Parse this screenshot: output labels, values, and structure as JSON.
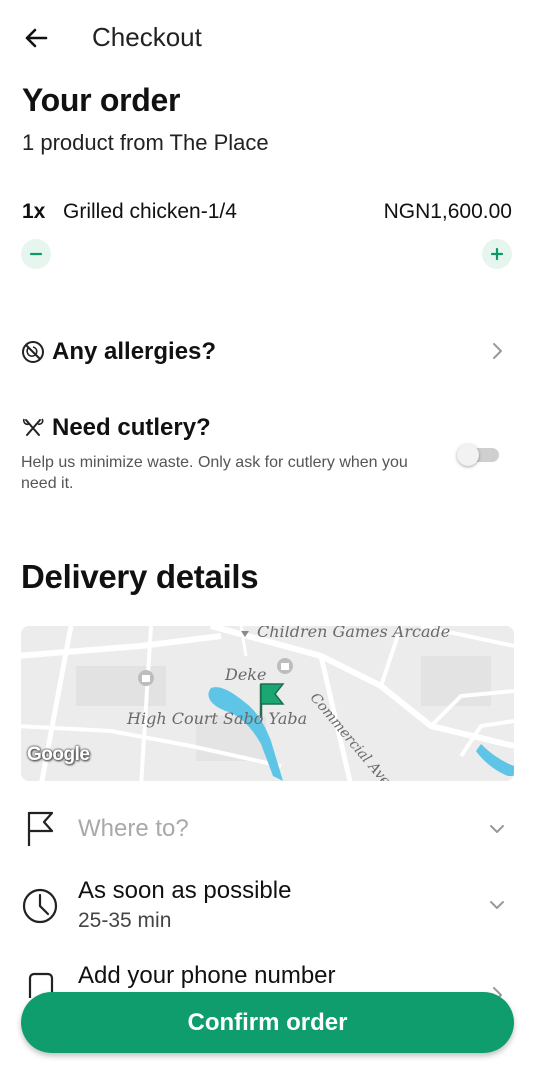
{
  "header": {
    "title": "Checkout",
    "back_icon": "arrow-left-icon"
  },
  "order": {
    "title": "Your order",
    "subtitle": "1 product from The Place",
    "items": [
      {
        "qty": "1x",
        "name": "Grilled chicken-1/4",
        "price": "NGN1,600.00"
      }
    ]
  },
  "allergies": {
    "label": "Any allergies?",
    "icon": "no-allergens-icon"
  },
  "cutlery": {
    "label": "Need cutlery?",
    "icon": "cutlery-icon",
    "help": "Help us minimize waste. Only ask for cutlery when you need it.",
    "enabled": false
  },
  "delivery": {
    "title": "Delivery details",
    "map": {
      "labels": {
        "poi_top": "Children Games Arcade",
        "poi_place": "Deke",
        "poi_court": "High Court Sabo Yaba",
        "street": "Commercial Ave"
      },
      "attribution": "Google"
    },
    "destination_placeholder": "Where to?",
    "time_label": "As soon as possible",
    "time_estimate": "25-35 min",
    "phone_label": "Add your phone number"
  },
  "confirm_label": "Confirm order",
  "colors": {
    "accent": "#0f9d6d",
    "accent_light": "#e7f5ef"
  }
}
